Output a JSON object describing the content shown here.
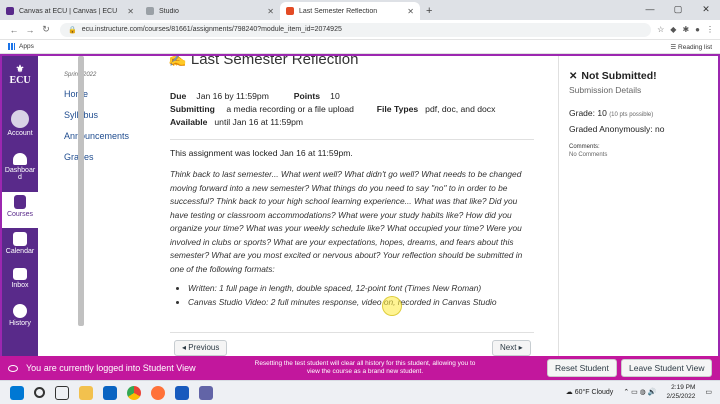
{
  "browser": {
    "tabs": [
      {
        "title": "Canvas at ECU | Canvas | ECU",
        "active": false,
        "fav_color": "#592a8a"
      },
      {
        "title": "Studio",
        "active": false,
        "fav_color": "#9aa0a6"
      },
      {
        "title": "Last Semester Reflection",
        "active": true,
        "fav_color": "#e34b25"
      }
    ],
    "new_tab": "+",
    "url": "ecu.instructure.com/courses/81661/assignments/798240?module_item_id=2074925",
    "bookmarks": {
      "apps": "Apps",
      "reading_list": "Reading list"
    }
  },
  "global_nav": {
    "logo": "ECU",
    "items": [
      {
        "label": "Account",
        "icon": "user-icon"
      },
      {
        "label": "Dashboard",
        "icon": "dashboard-icon"
      },
      {
        "label": "Courses",
        "icon": "book-icon",
        "active": true
      },
      {
        "label": "Calendar",
        "icon": "calendar-icon"
      },
      {
        "label": "Inbox",
        "icon": "inbox-icon"
      },
      {
        "label": "History",
        "icon": "clock-icon"
      }
    ]
  },
  "course_nav": {
    "term": "Spring 2022",
    "links": [
      "Home",
      "Syllabus",
      "Announcements",
      "Grades"
    ]
  },
  "assignment": {
    "title": "Last Semester Reflection",
    "due_label": "Due",
    "due_value": "Jan 16 by 11:59pm",
    "points_label": "Points",
    "points_value": "10",
    "submitting_label": "Submitting",
    "submitting_value": "a media recording or a file upload",
    "filetypes_label": "File Types",
    "filetypes_value": "pdf, doc, and docx",
    "available_label": "Available",
    "available_value": "until Jan 16 at 11:59pm",
    "locked_text": "This assignment was locked Jan 16 at 11:59pm.",
    "description": "Think back to last semester... What went well? What didn't go well? What needs to be changed moving forward into a new semester? What things do you need to say \"no\" to in order to be successful? Think back to your high school learning experience... What was that like? Did you have testing or classroom accommodations? What were your study habits like? How did you organize your time? What was your weekly schedule like? What occupied your time? Were you involved in clubs or sports? What are your expectations, hopes, dreams, and fears about this semester? What are you most excited or nervous about? Your reflection should be submitted in one of the following formats:",
    "formats": [
      "Written: 1 full page in length, double spaced, 12-point font (Times New Roman)",
      "Canvas Studio Video: 2 full minutes response, video on, recorded in Canvas Studio"
    ],
    "previous": "◂ Previous",
    "next": "Next ▸"
  },
  "sidebar": {
    "status": "Not Submitted!",
    "submission_details": "Submission Details",
    "grade": "Grade: 10",
    "grade_possible": "(10 pts possible)",
    "graded_anon": "Graded Anonymously: no",
    "comments_label": "Comments:",
    "comments_value": "No Comments"
  },
  "student_view": {
    "message": "You are currently logged into Student View",
    "warning": "Resetting the test student will clear all history for this student, allowing you to view the course as a brand new student.",
    "reset": "Reset Student",
    "leave": "Leave Student View",
    "color": "#c2179d"
  },
  "taskbar": {
    "weather": "60°F  Cloudy",
    "time": "2:19 PM",
    "date": "2/25/2022"
  }
}
